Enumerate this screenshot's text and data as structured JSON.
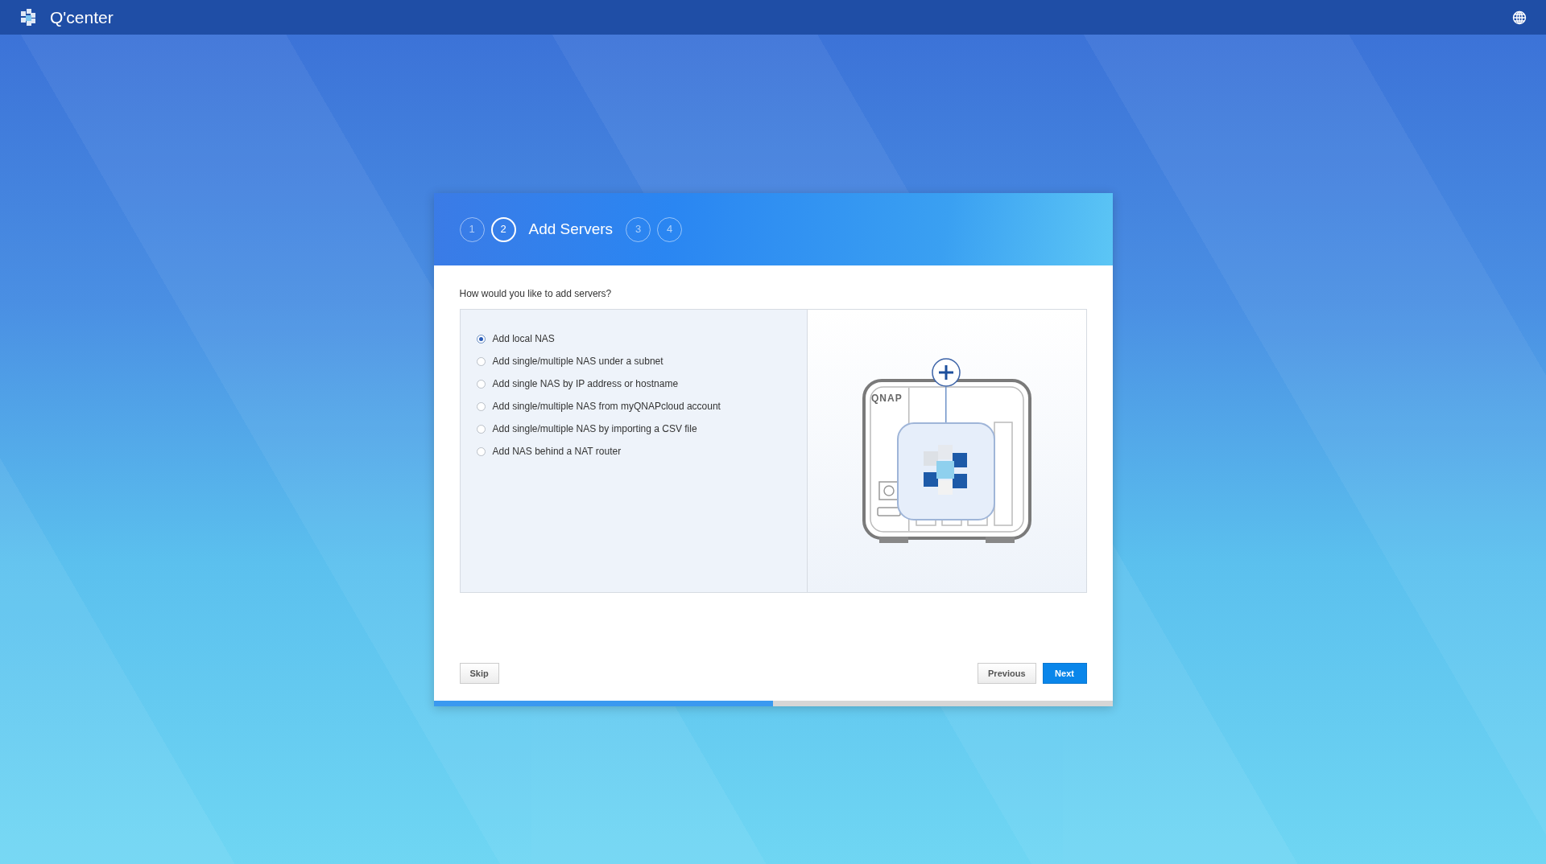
{
  "app": {
    "title": "Q'center"
  },
  "wizard": {
    "steps": [
      {
        "number": "1",
        "selected": false
      },
      {
        "number": "2",
        "selected": true,
        "label": "Add Servers"
      },
      {
        "number": "3",
        "selected": false
      },
      {
        "number": "4",
        "selected": false
      }
    ],
    "question": "How would you like to add servers?",
    "options": [
      {
        "label": "Add local NAS",
        "selected": true
      },
      {
        "label": "Add single/multiple NAS under a subnet",
        "selected": false
      },
      {
        "label": "Add single NAS by IP address or hostname",
        "selected": false
      },
      {
        "label": "Add single/multiple NAS from myQNAPcloud account",
        "selected": false
      },
      {
        "label": "Add single/multiple NAS by importing a CSV file",
        "selected": false
      },
      {
        "label": "Add NAS behind a NAT router",
        "selected": false
      }
    ],
    "illustration": {
      "device_text": "QNAP"
    },
    "buttons": {
      "skip": "Skip",
      "previous": "Previous",
      "next": "Next"
    },
    "progress": {
      "level": 0.5
    }
  }
}
